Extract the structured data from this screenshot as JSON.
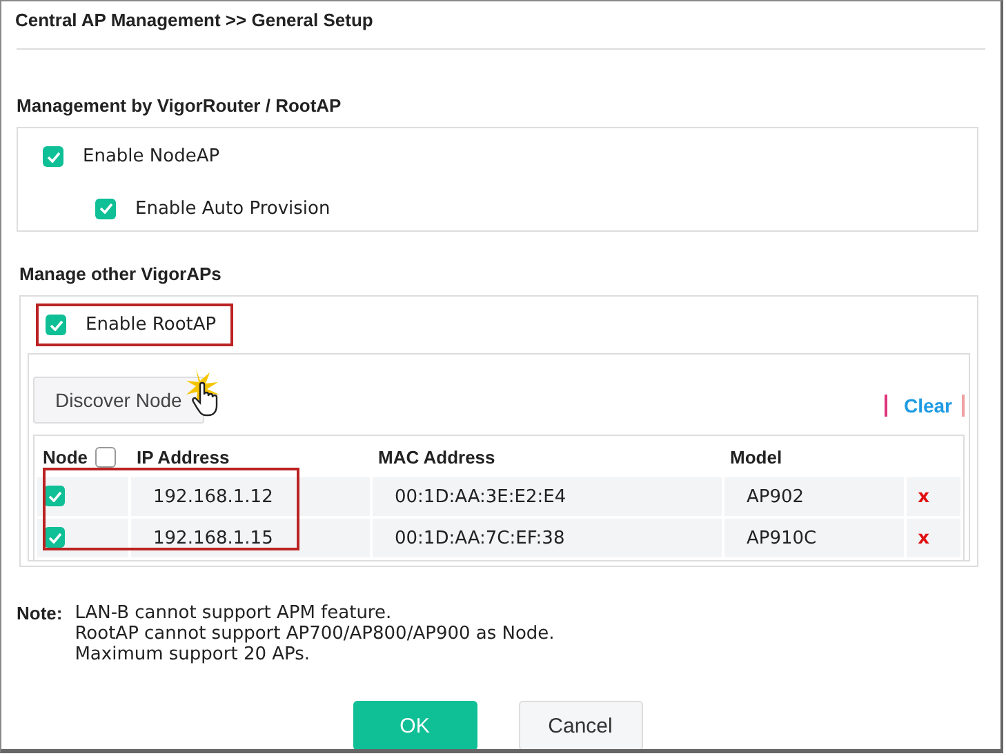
{
  "window": {
    "title": "Central AP Management >> General Setup"
  },
  "management": {
    "heading": "Management by VigorRouter / RootAP",
    "options": [
      {
        "label": "Enable NodeAP",
        "checked": true,
        "nested": false
      },
      {
        "label": "Enable Auto Provision",
        "checked": true,
        "nested": true
      }
    ]
  },
  "other": {
    "heading": "Manage other VigorAPs",
    "root_ap": {
      "label": "Enable RootAP",
      "checked": true,
      "highlighted": true
    },
    "discover_button": "Discover Node",
    "clear_link": "Clear",
    "table": {
      "columns": [
        "Node",
        "IP Address",
        "MAC Address",
        "Model"
      ],
      "select_all_checked": false,
      "rows_highlighted": true,
      "rows": [
        {
          "checked": true,
          "ip": "192.168.1.12",
          "mac": "00:1D:AA:3E:E2:E4",
          "model": "AP902",
          "delete": "x"
        },
        {
          "checked": true,
          "ip": "192.168.1.15",
          "mac": "00:1D:AA:7C:EF:38",
          "model": "AP910C",
          "delete": "x"
        }
      ]
    }
  },
  "note": {
    "label": "Note:",
    "lines": [
      "LAN-B cannot support APM feature.",
      "RootAP cannot support AP700/AP800/AP900 as Node.",
      "Maximum support 20 APs."
    ]
  },
  "buttons": [
    {
      "label": "OK",
      "kind": "primary"
    },
    {
      "label": "Cancel",
      "kind": "secondary"
    }
  ]
}
